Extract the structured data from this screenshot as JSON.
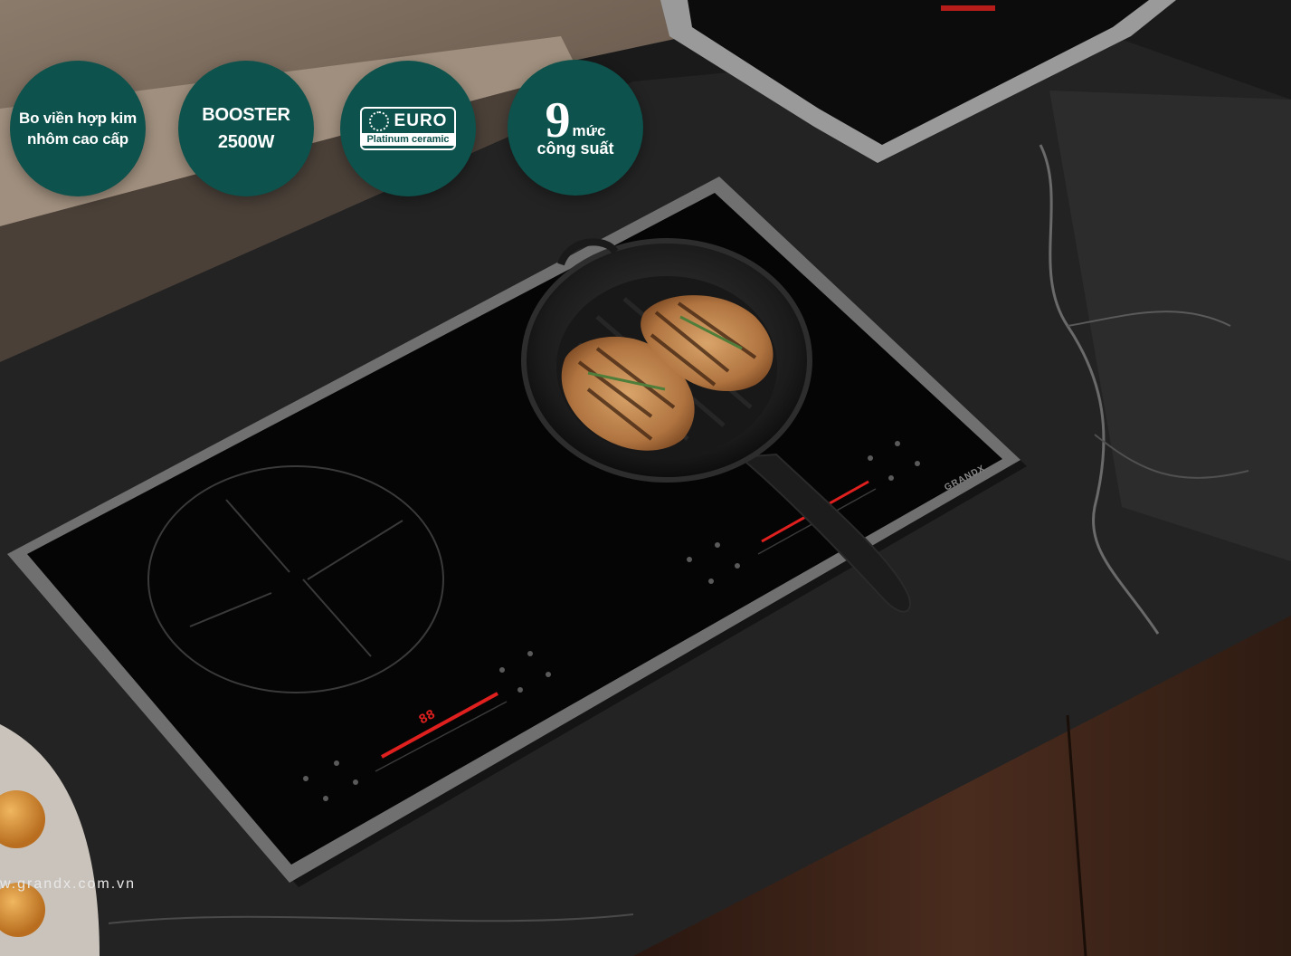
{
  "badges": {
    "frame": {
      "line1": "Bo viền hợp kim",
      "line2": "nhôm cao cấp"
    },
    "booster": {
      "line1": "BOOSTER",
      "line2": "2500W"
    },
    "euro": {
      "word": "EURO",
      "sub": "Platinum ceramic"
    },
    "levels": {
      "number": "9",
      "unit": "mức",
      "sub": "công suất"
    }
  },
  "cooktop": {
    "left_display": "88",
    "brand_mark": "GRANDX"
  },
  "website": "w.grandx.com.vn",
  "colors": {
    "badge_bg": "#0d524c",
    "countertop": "#232323",
    "cooktop_glass": "#050505",
    "frame": "#6f6f6f",
    "display_red": "#e0201e",
    "wood": "#3d2418"
  }
}
